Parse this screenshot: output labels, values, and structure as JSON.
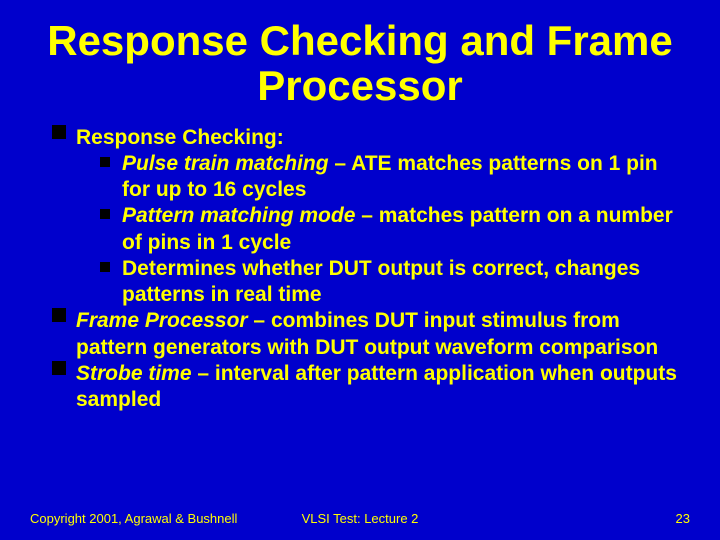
{
  "title": "Response Checking and Frame Processor",
  "bullets": {
    "b1": {
      "head": "Response Checking:"
    },
    "b1s1": {
      "em": "Pulse train matching",
      "rest": " – ATE matches patterns on 1 pin for up to 16 cycles"
    },
    "b1s2": {
      "em": "Pattern matching mode",
      "rest": " – matches pattern on a number of pins in 1 cycle"
    },
    "b1s3": {
      "rest": "Determines whether DUT output is correct, changes patterns in real time"
    },
    "b2": {
      "em": "Frame Processor",
      "rest": " – combines DUT input stimulus from pattern generators with DUT output waveform comparison"
    },
    "b3": {
      "em": "Strobe time",
      "rest": " – interval after pattern application when outputs sampled"
    }
  },
  "footer": {
    "left": "Copyright 2001, Agrawal & Bushnell",
    "center": "VLSI Test: Lecture 2",
    "right": "23"
  }
}
